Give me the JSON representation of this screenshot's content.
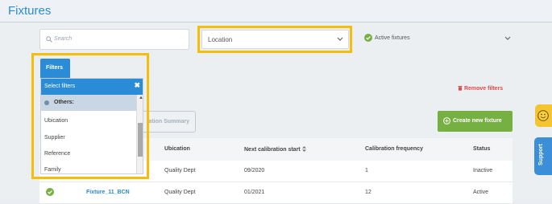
{
  "page": {
    "title": "Fixtures"
  },
  "search": {
    "placeholder": "Search",
    "icon": "search-icon"
  },
  "location": {
    "selected": "Location"
  },
  "active_filter": {
    "label": "Active fixtures",
    "color": "#76b043"
  },
  "remove_filters": "Remove filters",
  "buttons": {
    "summary_partial": "ration Summary",
    "create": "Create new fixture"
  },
  "filters_tab": "Filters",
  "dropdown": {
    "header": "Select filters",
    "group": "Others:",
    "items": [
      "Ubication",
      "Supplier",
      "Reference",
      "Family"
    ]
  },
  "table": {
    "columns": [
      "Ubication",
      "Next calibration start",
      "Calibration frequency",
      "Status"
    ],
    "rows": [
      {
        "name": "",
        "ubication": "Quality Dept",
        "next": "09/2020",
        "frequency": "1",
        "status": "Inactive"
      },
      {
        "name": "Fixture_11_BCN",
        "ubication": "Quality Dept",
        "next": "01/2021",
        "frequency": "12",
        "status": "Active"
      }
    ]
  },
  "side_tabs": {
    "support": "Support",
    "feedback_icon": "smiley-icon"
  },
  "colors": {
    "accent": "#2a8bd6",
    "highlight": "#f5be0b",
    "green": "#76b043",
    "red": "#e04a4a"
  }
}
